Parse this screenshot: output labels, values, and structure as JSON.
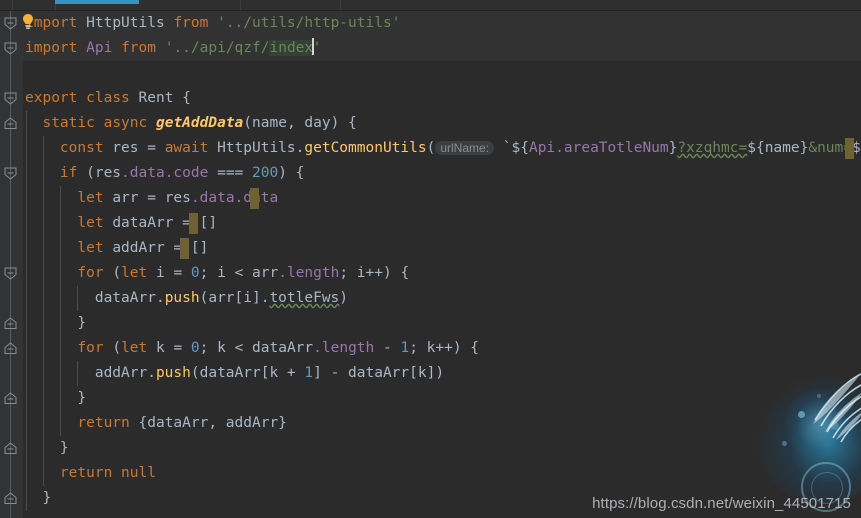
{
  "app": {
    "theme_name": "darcula",
    "background": "#2b2b2b",
    "gutter_background": "#313335",
    "accent": "#3592c4"
  },
  "topbar": {
    "accent_color": "#3592c4",
    "accent_label": ""
  },
  "watermark": {
    "url": "https://blog.csdn.net/weixin_44501715",
    "art_name": "blue-wing-glow-graphic"
  },
  "editor": {
    "language": "javascript",
    "caret_count": 5,
    "selection_text": "index",
    "inlay_hint": "urlName:",
    "typo_word": "totleFws",
    "lines": [
      {
        "n": 1,
        "indent": 0,
        "modified": true,
        "text": "import HttpUtils from '../utils/http-utils'",
        "tokens": [
          {
            "t": "import",
            "c": "kw"
          },
          {
            "t": " ",
            "c": "punc"
          },
          {
            "t": "HttpUtils",
            "c": "cls"
          },
          {
            "t": " ",
            "c": "punc"
          },
          {
            "t": "from",
            "c": "kw"
          },
          {
            "t": " ",
            "c": "punc"
          },
          {
            "t": "'../utils/http-utils'",
            "c": "str"
          }
        ]
      },
      {
        "n": 2,
        "indent": 0,
        "modified": true,
        "text": "import Api from '../api/qzf/index'",
        "tokens": [
          {
            "t": "import",
            "c": "kw"
          },
          {
            "t": " ",
            "c": "punc"
          },
          {
            "t": "Api",
            "c": "prop"
          },
          {
            "t": " ",
            "c": "punc"
          },
          {
            "t": "from",
            "c": "kw"
          },
          {
            "t": " ",
            "c": "punc"
          },
          {
            "t": "'../api/qzf/",
            "c": "str"
          },
          {
            "t": "index",
            "c": "str sel"
          },
          {
            "t": "'",
            "c": "str"
          }
        ]
      },
      {
        "n": 3,
        "indent": 0,
        "text": "",
        "tokens": []
      },
      {
        "n": 4,
        "indent": 0,
        "text": "export class Rent {",
        "tokens": [
          {
            "t": "export",
            "c": "kw"
          },
          {
            "t": " ",
            "c": "punc"
          },
          {
            "t": "class",
            "c": "kw"
          },
          {
            "t": " ",
            "c": "punc"
          },
          {
            "t": "Rent",
            "c": "cls"
          },
          {
            "t": " {",
            "c": "punc"
          }
        ]
      },
      {
        "n": 5,
        "indent": 1,
        "text": "  static async getAddData(name, day) {",
        "tokens": [
          {
            "t": "  ",
            "c": "punc"
          },
          {
            "t": "static",
            "c": "kw"
          },
          {
            "t": " ",
            "c": "punc"
          },
          {
            "t": "async",
            "c": "kw"
          },
          {
            "t": " ",
            "c": "punc"
          },
          {
            "t": "getAddData",
            "c": "fnd"
          },
          {
            "t": "(name, day) {",
            "c": "punc"
          }
        ]
      },
      {
        "n": 6,
        "indent": 2,
        "text": "    const res = await HttpUtils.getCommonUtils( urlName: `${Api.areaTotleNum}?xzqhmc=${name}&num=${day}`)",
        "tokens": [
          {
            "t": "    ",
            "c": "punc"
          },
          {
            "t": "const",
            "c": "kw"
          },
          {
            "t": " res = ",
            "c": "punc"
          },
          {
            "t": "await",
            "c": "kw"
          },
          {
            "t": " ",
            "c": "punc"
          },
          {
            "t": "HttpUtils",
            "c": "cls"
          },
          {
            "t": ".",
            "c": "punc"
          },
          {
            "t": "getCommonUtils",
            "c": "fn"
          },
          {
            "t": "(",
            "c": "punc"
          },
          {
            "t": "urlName:",
            "c": "hint"
          },
          {
            "t": " `",
            "c": "tpl"
          },
          {
            "t": "${",
            "c": "tpl"
          },
          {
            "t": "Api.areaTotleNum",
            "c": "tplv"
          },
          {
            "t": "}",
            "c": "tpl"
          },
          {
            "t": "?xzqhmc=",
            "c": "urlg typo"
          },
          {
            "t": "${name}",
            "c": "tpl"
          },
          {
            "t": "&num=",
            "c": "urlg"
          },
          {
            "t": "${day}",
            "c": "tpl"
          },
          {
            "t": "`)",
            "c": "tpl"
          }
        ]
      },
      {
        "n": 7,
        "indent": 2,
        "text": "    if (res.data.code === 200) {",
        "tokens": [
          {
            "t": "    ",
            "c": "punc"
          },
          {
            "t": "if",
            "c": "kw"
          },
          {
            "t": " (res",
            "c": "punc"
          },
          {
            "t": ".data",
            "c": "prop"
          },
          {
            "t": ".code",
            "c": "prop"
          },
          {
            "t": " === ",
            "c": "punc"
          },
          {
            "t": "200",
            "c": "num"
          },
          {
            "t": ") {",
            "c": "punc"
          }
        ]
      },
      {
        "n": 8,
        "indent": 3,
        "text": "      let arr = res.data.data",
        "tokens": [
          {
            "t": "      ",
            "c": "punc"
          },
          {
            "t": "let",
            "c": "kw"
          },
          {
            "t": " arr = res",
            "c": "punc"
          },
          {
            "t": ".data",
            "c": "prop"
          },
          {
            "t": ".data",
            "c": "prop"
          }
        ]
      },
      {
        "n": 9,
        "indent": 3,
        "text": "      let dataArr = []",
        "tokens": [
          {
            "t": "      ",
            "c": "punc"
          },
          {
            "t": "let",
            "c": "kw"
          },
          {
            "t": " dataArr = []",
            "c": "punc"
          }
        ]
      },
      {
        "n": 10,
        "indent": 3,
        "text": "      let addArr = []",
        "tokens": [
          {
            "t": "      ",
            "c": "punc"
          },
          {
            "t": "let",
            "c": "kw"
          },
          {
            "t": " addArr = []",
            "c": "punc"
          }
        ]
      },
      {
        "n": 11,
        "indent": 3,
        "text": "      for (let i = 0; i < arr.length; i++) {",
        "tokens": [
          {
            "t": "      ",
            "c": "punc"
          },
          {
            "t": "for",
            "c": "kw"
          },
          {
            "t": " (",
            "c": "punc"
          },
          {
            "t": "let",
            "c": "kw"
          },
          {
            "t": " i = ",
            "c": "punc"
          },
          {
            "t": "0",
            "c": "num"
          },
          {
            "t": "; i < arr",
            "c": "punc"
          },
          {
            "t": ".length",
            "c": "prop"
          },
          {
            "t": "; i++) {",
            "c": "punc"
          }
        ]
      },
      {
        "n": 12,
        "indent": 4,
        "text": "        dataArr.push(arr[i].totleFws)",
        "tokens": [
          {
            "t": "        dataArr.",
            "c": "punc"
          },
          {
            "t": "push",
            "c": "fn"
          },
          {
            "t": "(arr[i].",
            "c": "punc"
          },
          {
            "t": "totleFws",
            "c": "punc typo"
          },
          {
            "t": ")",
            "c": "punc"
          }
        ]
      },
      {
        "n": 13,
        "indent": 3,
        "text": "      }",
        "tokens": [
          {
            "t": "      }",
            "c": "punc"
          }
        ]
      },
      {
        "n": 14,
        "indent": 3,
        "text": "      for (let k = 0; k < dataArr.length - 1; k++) {",
        "tokens": [
          {
            "t": "      ",
            "c": "punc"
          },
          {
            "t": "for",
            "c": "kw"
          },
          {
            "t": " (",
            "c": "punc"
          },
          {
            "t": "let",
            "c": "kw"
          },
          {
            "t": " k = ",
            "c": "punc"
          },
          {
            "t": "0",
            "c": "num"
          },
          {
            "t": "; k < dataArr",
            "c": "punc"
          },
          {
            "t": ".length",
            "c": "prop"
          },
          {
            "t": " - ",
            "c": "punc"
          },
          {
            "t": "1",
            "c": "num"
          },
          {
            "t": "; k++) {",
            "c": "punc"
          }
        ]
      },
      {
        "n": 15,
        "indent": 4,
        "text": "        addArr.push(dataArr[k + 1] - dataArr[k])",
        "tokens": [
          {
            "t": "        addArr.",
            "c": "punc"
          },
          {
            "t": "push",
            "c": "fn"
          },
          {
            "t": "(dataArr[k + ",
            "c": "punc"
          },
          {
            "t": "1",
            "c": "num"
          },
          {
            "t": "] - dataArr[k])",
            "c": "punc"
          }
        ]
      },
      {
        "n": 16,
        "indent": 3,
        "text": "      }",
        "tokens": [
          {
            "t": "      }",
            "c": "punc"
          }
        ]
      },
      {
        "n": 17,
        "indent": 3,
        "text": "      return {dataArr, addArr}",
        "tokens": [
          {
            "t": "      ",
            "c": "punc"
          },
          {
            "t": "return",
            "c": "kw"
          },
          {
            "t": " {dataArr, addArr}",
            "c": "punc"
          }
        ]
      },
      {
        "n": 18,
        "indent": 2,
        "text": "    }",
        "tokens": [
          {
            "t": "    }",
            "c": "punc"
          }
        ]
      },
      {
        "n": 19,
        "indent": 2,
        "text": "    return null",
        "tokens": [
          {
            "t": "    ",
            "c": "punc"
          },
          {
            "t": "return",
            "c": "kw"
          },
          {
            "t": " ",
            "c": "punc"
          },
          {
            "t": "null",
            "c": "kw"
          }
        ]
      },
      {
        "n": 20,
        "indent": 1,
        "text": "  }",
        "tokens": [
          {
            "t": "  }",
            "c": "punc"
          }
        ]
      }
    ]
  },
  "gutter": {
    "icons": [
      {
        "name": "fold-expanded-icon",
        "line": 1
      },
      {
        "name": "fold-expanded-icon",
        "line": 2
      },
      {
        "name": "fold-expanded-icon",
        "line": 4
      },
      {
        "name": "fold-collapsed-icon",
        "line": 5
      },
      {
        "name": "fold-expanded-icon",
        "line": 7
      },
      {
        "name": "fold-expanded-icon",
        "line": 11
      },
      {
        "name": "fold-collapsed-icon",
        "line": 13
      },
      {
        "name": "fold-collapsed-icon",
        "line": 14
      },
      {
        "name": "fold-collapsed-icon",
        "line": 16
      },
      {
        "name": "fold-collapsed-icon",
        "line": 18
      },
      {
        "name": "fold-collapsed-icon",
        "line": 20
      }
    ],
    "intention_icon": "lightbulb-icon"
  }
}
